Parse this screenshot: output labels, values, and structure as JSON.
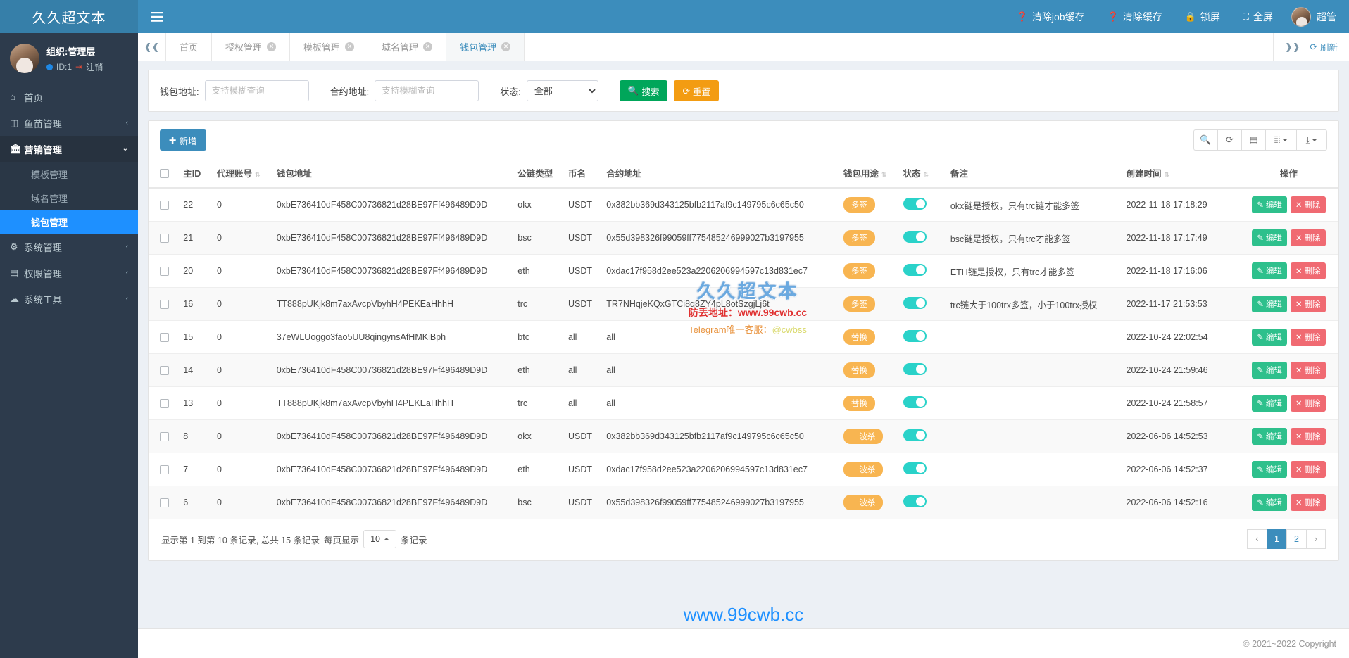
{
  "brand": {
    "logo_text": "久久超文本"
  },
  "topnav": {
    "items": [
      {
        "icon": "question-circle-icon",
        "label": "清除job缓存"
      },
      {
        "icon": "question-circle-icon",
        "label": "清除缓存"
      },
      {
        "icon": "lock-icon",
        "label": "锁屏"
      },
      {
        "icon": "fullscreen-icon",
        "label": "全屏"
      }
    ],
    "user_label": "超管"
  },
  "user_panel": {
    "org": "组织:管理层",
    "id": "ID:1",
    "logout": "注销"
  },
  "sidebar": {
    "items": [
      {
        "icon": "home-icon",
        "label": "首页",
        "arrow": "",
        "type": "link"
      },
      {
        "icon": "fish-icon",
        "label": "鱼苗管理",
        "arrow": "‹",
        "type": "group"
      },
      {
        "icon": "bank-icon",
        "label": "营销管理",
        "arrow": "⌄",
        "type": "group-open"
      },
      {
        "icon": "gear-icon",
        "label": "系统管理",
        "arrow": "‹",
        "type": "group"
      },
      {
        "icon": "id-card-icon",
        "label": "权限管理",
        "arrow": "‹",
        "type": "group"
      },
      {
        "icon": "cloud-icon",
        "label": "系统工具",
        "arrow": "‹",
        "type": "group"
      }
    ],
    "submenu": [
      {
        "label": "模板管理",
        "active": false
      },
      {
        "label": "域名管理",
        "active": false
      },
      {
        "label": "钱包管理",
        "active": true
      }
    ]
  },
  "tabbar": {
    "collapse_icon": "double-chevron-left-icon",
    "tabs": [
      {
        "label": "首页",
        "closable": false,
        "active": false
      },
      {
        "label": "授权管理",
        "closable": true,
        "active": false
      },
      {
        "label": "模板管理",
        "closable": true,
        "active": false
      },
      {
        "label": "域名管理",
        "closable": true,
        "active": false
      },
      {
        "label": "钱包管理",
        "closable": true,
        "active": true
      }
    ],
    "expand_icon": "double-chevron-right-icon",
    "refresh_label": "刷新"
  },
  "filters": {
    "wallet": {
      "label": "钱包地址:",
      "value": "",
      "placeholder": "支持模糊查询"
    },
    "contract": {
      "label": "合约地址:",
      "value": "",
      "placeholder": "支持模糊查询"
    },
    "status": {
      "label": "状态:",
      "value": "全部",
      "options": [
        "全部"
      ]
    },
    "search_label": "搜索",
    "reset_label": "重置"
  },
  "toolbar": {
    "add_label": "新增",
    "icons": [
      "search-icon",
      "refresh-icon",
      "list-icon",
      "columns-icon",
      "export-icon"
    ]
  },
  "table": {
    "columns": [
      {
        "key": "check",
        "label": "",
        "sortable": false
      },
      {
        "key": "id",
        "label": "主ID",
        "sortable": false
      },
      {
        "key": "agent",
        "label": "代理账号",
        "sortable": true
      },
      {
        "key": "wallet",
        "label": "钱包地址",
        "sortable": false
      },
      {
        "key": "chain",
        "label": "公链类型",
        "sortable": false
      },
      {
        "key": "coin",
        "label": "币名",
        "sortable": false
      },
      {
        "key": "contract",
        "label": "合约地址",
        "sortable": false
      },
      {
        "key": "use",
        "label": "钱包用途",
        "sortable": true
      },
      {
        "key": "state",
        "label": "状态",
        "sortable": true
      },
      {
        "key": "remark",
        "label": "备注",
        "sortable": false
      },
      {
        "key": "time",
        "label": "创建时间",
        "sortable": true
      },
      {
        "key": "op",
        "label": "操作",
        "sortable": false
      }
    ],
    "rows": [
      {
        "id": "22",
        "agent": "0",
        "wallet": "0xbE736410dF458C00736821d28BE97Ff496489D9D",
        "chain": "okx",
        "coin": "USDT",
        "contract": "0x382bb369d343125bfb2117af9c149795c6c65c50",
        "use": "多签",
        "state": true,
        "remark": "okx链是授权，只有trc链才能多签",
        "time": "2022-11-18 17:18:29"
      },
      {
        "id": "21",
        "agent": "0",
        "wallet": "0xbE736410dF458C00736821d28BE97Ff496489D9D",
        "chain": "bsc",
        "coin": "USDT",
        "contract": "0x55d398326f99059ff775485246999027b3197955",
        "use": "多签",
        "state": true,
        "remark": "bsc链是授权，只有trc才能多签",
        "time": "2022-11-18 17:17:49"
      },
      {
        "id": "20",
        "agent": "0",
        "wallet": "0xbE736410dF458C00736821d28BE97Ff496489D9D",
        "chain": "eth",
        "coin": "USDT",
        "contract": "0xdac17f958d2ee523a2206206994597c13d831ec7",
        "use": "多签",
        "state": true,
        "remark": "ETH链是授权，只有trc才能多签",
        "time": "2022-11-18 17:16:06"
      },
      {
        "id": "16",
        "agent": "0",
        "wallet": "TT888pUKjk8m7axAvcpVbyhH4PEKEaHhhH",
        "chain": "trc",
        "coin": "USDT",
        "contract": "TR7NHqjeKQxGTCi8q8ZY4pL8otSzgjLj6t",
        "use": "多签",
        "state": true,
        "remark": "trc链大于100trx多签，小于100trx授权",
        "time": "2022-11-17 21:53:53"
      },
      {
        "id": "15",
        "agent": "0",
        "wallet": "37eWLUoggo3fao5UU8qingynsAfHMKiBph",
        "chain": "btc",
        "coin": "all",
        "contract": "all",
        "use": "替换",
        "state": true,
        "remark": "",
        "time": "2022-10-24 22:02:54"
      },
      {
        "id": "14",
        "agent": "0",
        "wallet": "0xbE736410dF458C00736821d28BE97Ff496489D9D",
        "chain": "eth",
        "coin": "all",
        "contract": "all",
        "use": "替换",
        "state": true,
        "remark": "",
        "time": "2022-10-24 21:59:46"
      },
      {
        "id": "13",
        "agent": "0",
        "wallet": "TT888pUKjk8m7axAvcpVbyhH4PEKEaHhhH",
        "chain": "trc",
        "coin": "all",
        "contract": "all",
        "use": "替换",
        "state": true,
        "remark": "",
        "time": "2022-10-24 21:58:57"
      },
      {
        "id": "8",
        "agent": "0",
        "wallet": "0xbE736410dF458C00736821d28BE97Ff496489D9D",
        "chain": "okx",
        "coin": "USDT",
        "contract": "0x382bb369d343125bfb2117af9c149795c6c65c50",
        "use": "一波杀",
        "state": true,
        "remark": "",
        "time": "2022-06-06 14:52:53"
      },
      {
        "id": "7",
        "agent": "0",
        "wallet": "0xbE736410dF458C00736821d28BE97Ff496489D9D",
        "chain": "eth",
        "coin": "USDT",
        "contract": "0xdac17f958d2ee523a2206206994597c13d831ec7",
        "use": "一波杀",
        "state": true,
        "remark": "",
        "time": "2022-06-06 14:52:37"
      },
      {
        "id": "6",
        "agent": "0",
        "wallet": "0xbE736410dF458C00736821d28BE97Ff496489D9D",
        "chain": "bsc",
        "coin": "USDT",
        "contract": "0x55d398326f99059ff775485246999027b3197955",
        "use": "一波杀",
        "state": true,
        "remark": "",
        "time": "2022-06-06 14:52:16"
      }
    ],
    "edit_label": "编辑",
    "delete_label": "删除"
  },
  "pagination": {
    "info_prefix": "显示第 1 到第 10 条记录, 总共 15 条记录",
    "per_page_label": "每页显示",
    "per_page_value": "10",
    "records_label": "条记录",
    "prev": "‹",
    "pages": [
      "1",
      "2"
    ],
    "next": "›",
    "active_page": "1"
  },
  "watermark": {
    "title": "久久超文本",
    "line1": "防丢地址：www.99cwb.cc",
    "line2_prefix": "Telegram唯一客服：",
    "line2_handle": "@cwbss"
  },
  "footer": {
    "site": "www.99cwb.cc",
    "copyright": "© 2021~2022 Copyright"
  }
}
